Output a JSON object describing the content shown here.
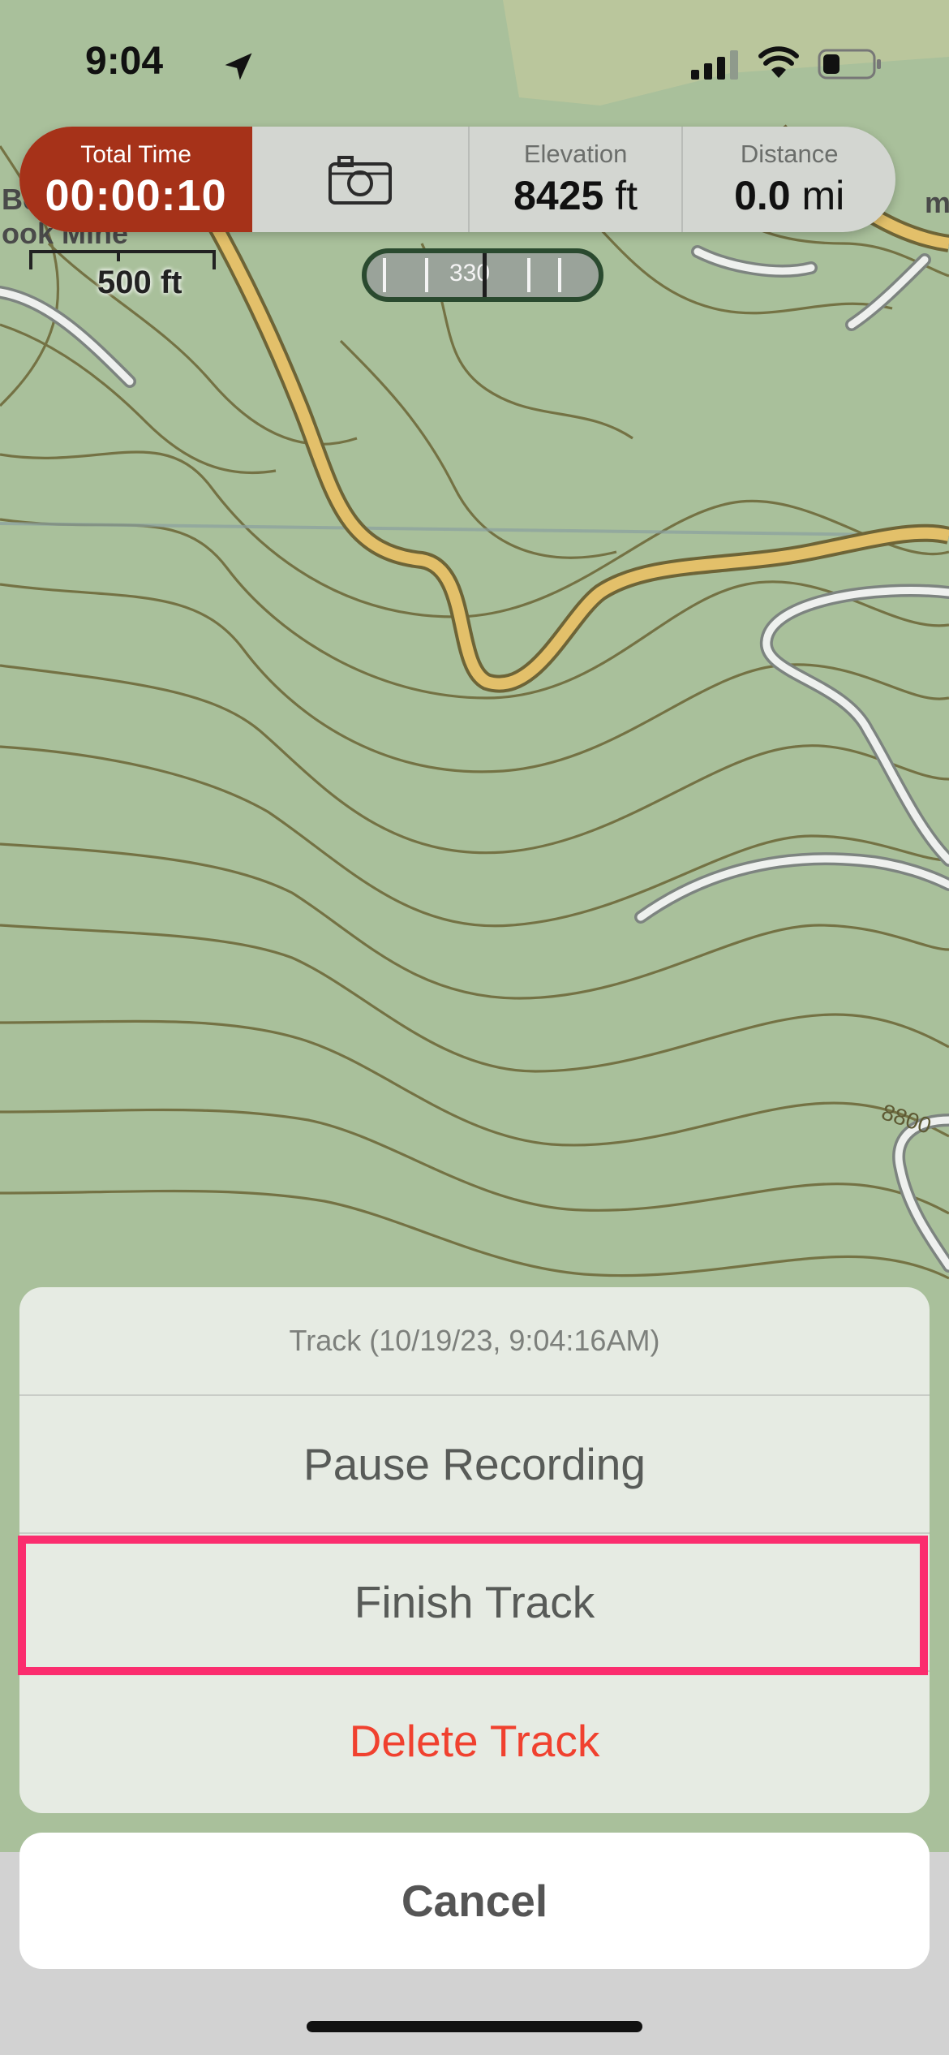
{
  "status_bar": {
    "time": "9:04"
  },
  "tracking_panel": {
    "total_time_label": "Total Time",
    "total_time_value": "00:00:10",
    "elevation_label": "Elevation",
    "elevation_value": "8425",
    "elevation_unit": "ft",
    "distance_label": "Distance",
    "distance_value": "0.0",
    "distance_unit": "mi"
  },
  "map": {
    "scale_label": "500 ft",
    "compass_heading": "330",
    "place_label": "ook Mine",
    "place_label_fragment": "Be",
    "contour_label": "8800",
    "right_edge_label": "m"
  },
  "action_sheet": {
    "title": "Track (10/19/23, 9:04:16AM)",
    "pause_label": "Pause Recording",
    "finish_label": "Finish Track",
    "delete_label": "Delete Track",
    "cancel_label": "Cancel"
  },
  "colors": {
    "map_bg": "#a9c09b",
    "contour": "#6f6a3b",
    "road_yellow": "#e3c06a",
    "time_accent": "#a63219",
    "destructive": "#f0412f",
    "highlight": "#fb2d6e"
  }
}
